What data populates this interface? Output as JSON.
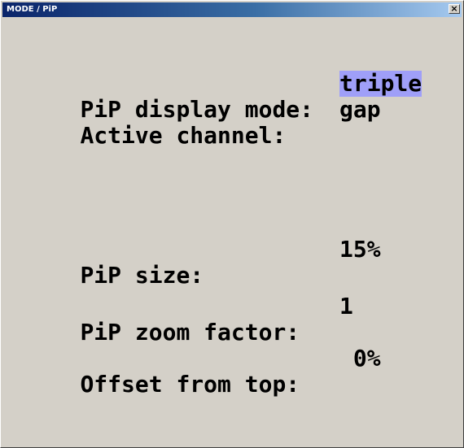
{
  "window": {
    "title": "MODE / PiP",
    "close_glyph": "×"
  },
  "settings": [
    {
      "label": "PiP display mode:",
      "value": "triple",
      "selected": true
    },
    {
      "label": "Active channel:",
      "value": "gap",
      "selected": false
    },
    {
      "label": "PiP size:",
      "value": "15%",
      "selected": false
    },
    {
      "label": "PiP zoom factor:",
      "value": "1",
      "selected": false
    },
    {
      "label": "Offset from top:",
      "value": " 0%",
      "selected": false
    }
  ],
  "colors": {
    "background": "#d4d0c8",
    "title_bar_start": "#0a246a",
    "title_bar_end": "#a6caf0",
    "selection": "#9f9ff8"
  }
}
